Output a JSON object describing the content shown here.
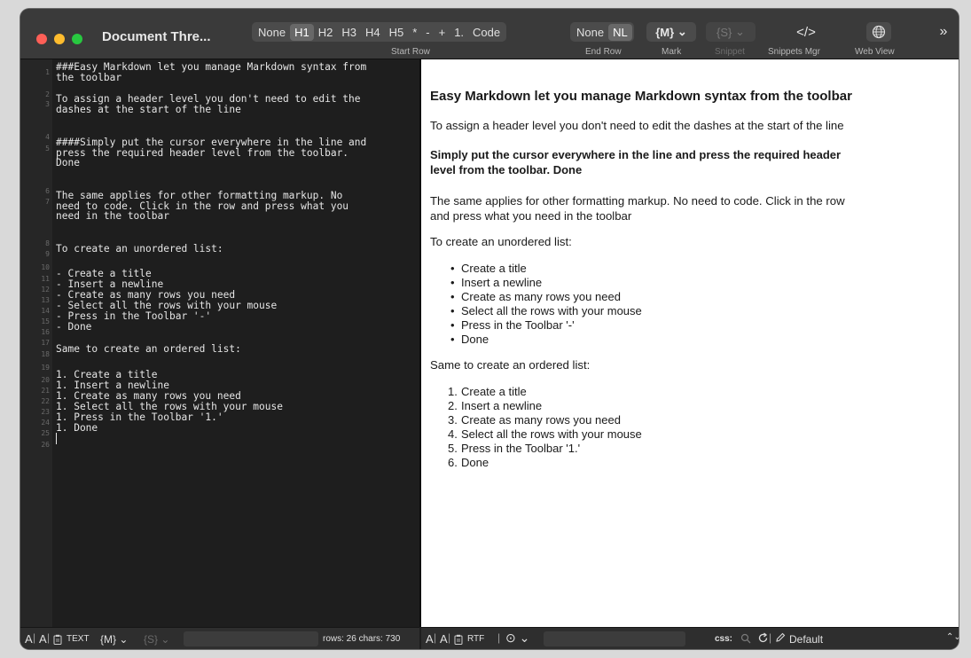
{
  "window": {
    "title": "Document Thre..."
  },
  "toolbar": {
    "start_row": {
      "buttons": [
        "None",
        "H1",
        "H2",
        "H3",
        "H4",
        "H5",
        "*",
        "-",
        "+",
        "1.",
        "Code"
      ],
      "active": "H1",
      "label": "Start Row"
    },
    "end_row": {
      "buttons": [
        "None",
        "NL"
      ],
      "active": "NL",
      "label": "End Row"
    },
    "mark": {
      "value": "{M}",
      "chevron": "⌄",
      "label": "Mark"
    },
    "snippet": {
      "value": "{S}",
      "chevron": "⌄",
      "label": "Snippet"
    },
    "snippets_mgr": {
      "glyph": "</>",
      "label": "Snippets Mgr"
    },
    "web_view": {
      "label": "Web View"
    },
    "overflow": "»"
  },
  "editor": {
    "line_numbers": [
      "1",
      "2",
      "3",
      "4",
      "5",
      "6",
      "7",
      "8",
      "9",
      "10",
      "11",
      "12",
      "13",
      "14",
      "15",
      "16",
      "17",
      "18",
      "19",
      "20",
      "21",
      "22",
      "23",
      "24",
      "25",
      "26"
    ],
    "lines": [
      "###Easy Markdown let you manage Markdown syntax from\nthe toolbar",
      "",
      "To assign a header level you don't need to edit the\ndashes at the start of the line",
      "",
      "####Simply put the cursor everywhere in the line and\npress the required header level from the toolbar.\nDone",
      "",
      "The same applies for other formatting markup. No\nneed to code. Click in the row and press what you\nneed in the toolbar",
      "",
      "To create an unordered list:",
      "",
      "- Create a title",
      "- Insert a newline",
      "- Create as many rows you need",
      "- Select all the rows with your mouse",
      "- Press in the Toolbar '-'",
      "- Done",
      "",
      "Same to create an ordered list:",
      "",
      "1. Create a title",
      "1. Insert a newline",
      "1. Create as many rows you need",
      "1. Select all the rows with your mouse",
      "1. Press in the Toolbar '1.'",
      "1. Done",
      ""
    ]
  },
  "preview": {
    "h1": "Easy Markdown let you manage Markdown syntax from the toolbar",
    "p1": "To assign a header level you don't need to edit the dashes at the start of the line",
    "h2_line1": "Simply put the cursor everywhere in the line and press the required header",
    "h2_line2": "level from the toolbar. Done",
    "p2_line1": "The same applies for other formatting markup. No need to code. Click in the row",
    "p2_line2": "and press what you need in the toolbar",
    "ul_intro": "To create an unordered list:",
    "ul_items": [
      "Create a title",
      "Insert a newline",
      "Create as many rows you need",
      "Select all the rows with your mouse",
      "Press in the Toolbar '-'",
      "Done"
    ],
    "ol_intro": "Same to create an ordered list:",
    "ol_items": [
      "Create a title",
      "Insert a newline",
      "Create as many rows you need",
      "Select all the rows with your mouse",
      "Press in the Toolbar '1.'",
      "Done"
    ]
  },
  "status_left": {
    "font_a": "A",
    "font_a2": "A",
    "text_label": "TEXT",
    "mark": "{M}",
    "mark_chevron": "⌄",
    "snippet": "{S}",
    "snippet_chevron": "⌄",
    "stats": "rows: 26 chars: 730"
  },
  "status_right": {
    "font_a": "A",
    "font_a2": "A",
    "rtf_label": "RTF",
    "more": "⊙",
    "more_chevron": "⌄",
    "css_label": "css:",
    "css_value": "Default",
    "stepper": "⌃⌄"
  }
}
